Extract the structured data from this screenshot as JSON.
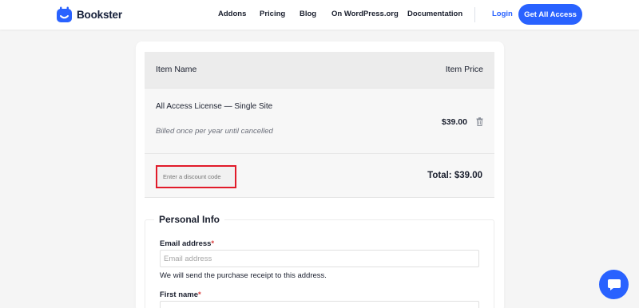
{
  "brand": {
    "name": "Bookster",
    "accent": "#2962ff"
  },
  "nav": {
    "links": [
      "Addons",
      "Pricing",
      "Blog",
      "On WordPress.org",
      "Documentation"
    ],
    "login": "Login",
    "cta": "Get All Access"
  },
  "cart": {
    "columns": {
      "name": "Item Name",
      "price": "Item Price"
    },
    "item": {
      "name": "All Access License — Single Site",
      "billing": "Billed once per year until cancelled",
      "price": "$39.00"
    },
    "discount_placeholder": "Enter a discount code",
    "total": "Total: $39.00",
    "highlight_color": "#e11b2a"
  },
  "personal_info": {
    "legend": "Personal Info",
    "email_label": "Email address",
    "email_placeholder": "Email address",
    "email_help": "We will send the purchase receipt to this address.",
    "first_name_label": "First name",
    "required_marker": "*"
  }
}
